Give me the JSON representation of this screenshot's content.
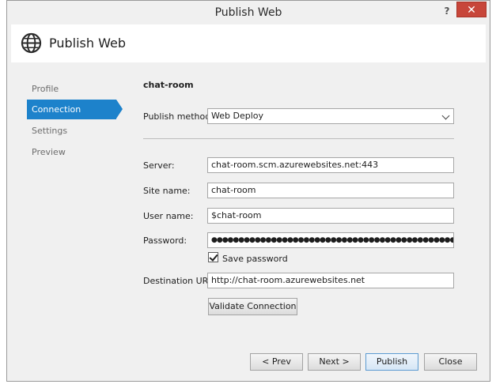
{
  "window": {
    "title": "Publish Web",
    "help_label": "?",
    "close_label": "✕"
  },
  "header": {
    "title": "Publish Web",
    "icon": "globe-icon"
  },
  "sidebar": {
    "items": [
      {
        "label": "Profile",
        "active": false
      },
      {
        "label": "Connection",
        "active": true
      },
      {
        "label": "Settings",
        "active": false
      },
      {
        "label": "Preview",
        "active": false
      }
    ]
  },
  "form": {
    "profile_name": "chat-room",
    "publish_method_label": "Publish method:",
    "publish_method_value": "Web Deploy",
    "server_label": "Server:",
    "server_value": "chat-room.scm.azurewebsites.net:443",
    "site_name_label": "Site name:",
    "site_name_value": "chat-room",
    "user_name_label": "User name:",
    "user_name_value": "$chat-room",
    "password_label": "Password:",
    "password_value": "●●●●●●●●●●●●●●●●●●●●●●●●●●●●●●●●●●●●●●●●●●●●●●●●●●●●●●●●●●●●●●",
    "save_password_label": "Save password",
    "save_password_checked": true,
    "destination_url_label": "Destination URL:",
    "destination_url_value": "http://chat-room.azurewebsites.net",
    "validate_button": "Validate Connection"
  },
  "footer": {
    "prev_button": "< Prev",
    "next_button": "Next >",
    "publish_button": "Publish",
    "close_button": "Close"
  },
  "colors": {
    "accent": "#1d82cb",
    "close_red": "#c7463a"
  }
}
